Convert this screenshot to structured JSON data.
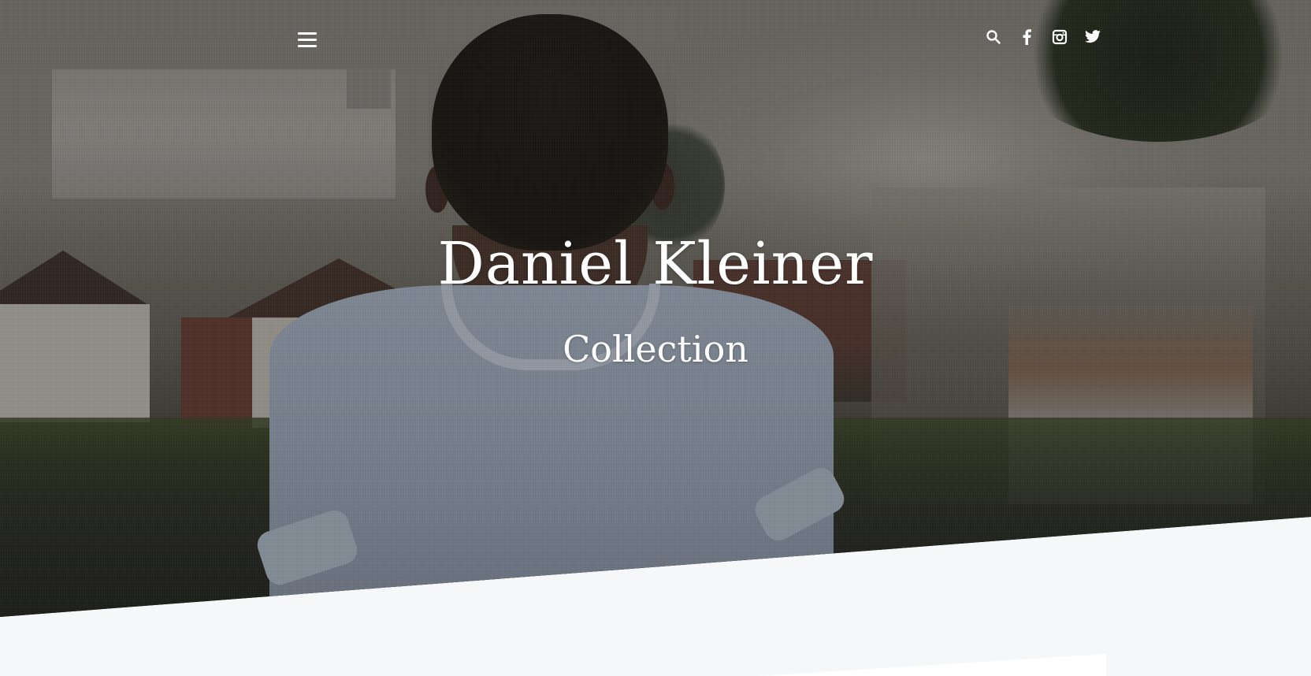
{
  "header": {
    "menu_icon": "hamburger-menu-icon",
    "icons": [
      {
        "name": "search-icon",
        "label": "Search"
      },
      {
        "name": "facebook-icon",
        "label": "Facebook"
      },
      {
        "name": "instagram-icon",
        "label": "Instagram"
      },
      {
        "name": "twitter-icon",
        "label": "Twitter"
      }
    ]
  },
  "hero": {
    "title": "Daniel Kleiner",
    "subtitle": "Collection"
  },
  "colors": {
    "text": "#ffffff",
    "background": "#f6f7f9"
  }
}
